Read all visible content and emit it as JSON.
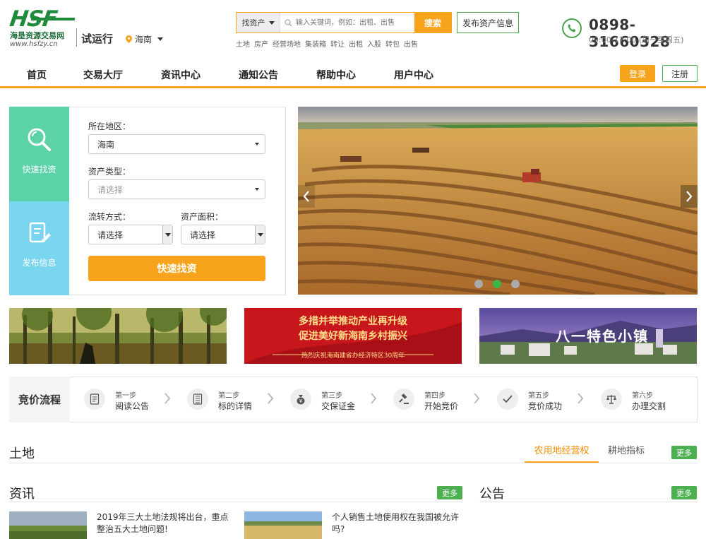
{
  "header": {
    "logo_mark": "HSF",
    "logo_name": "海垦资源交易网",
    "logo_url": "www.hsfzy.cn",
    "trial_label": "试运行",
    "region": "海南",
    "search": {
      "type": "找资产",
      "placeholder": "输入关键词，例如：出租、出售",
      "button": "搜索"
    },
    "publish_button": "发布资产信息",
    "hot_keywords": [
      "土地",
      "房产",
      "经营场地",
      "集装箱",
      "转让",
      "出租",
      "入股",
      "转包",
      "出售"
    ],
    "phone": "0898-31660328",
    "hours": "09:00-17:00 (周一至周五)"
  },
  "nav": {
    "items": [
      "首页",
      "交易大厅",
      "资讯中心",
      "通知公告",
      "帮助中心",
      "用户中心"
    ],
    "login": "登录",
    "register": "注册"
  },
  "quick_panel": {
    "tab_search": "快速找资",
    "tab_publish": "发布信息",
    "region_label": "所在地区：",
    "region_value": "海南",
    "type_label": "资产类型：",
    "type_value": "请选择",
    "transfer_label": "流转方式：",
    "transfer_value": "请选择",
    "area_label": "资产面积：",
    "area_value": "请选择",
    "button": "快速找资"
  },
  "banner": {
    "active_dot": 1,
    "dots": 3
  },
  "tiles": {
    "tile2_line1": "多措并举推动产业再升级",
    "tile2_line2": "促进美好新海南乡村振兴",
    "tile2_line3": "热烈庆祝海南建省办经济特区30周年",
    "tile3_text": "八一特色小镇"
  },
  "process": {
    "title": "竞价流程",
    "steps": [
      {
        "n": "第一步",
        "t": "阅读公告",
        "icon": "document-icon"
      },
      {
        "n": "第二步",
        "t": "标的详情",
        "icon": "list-icon"
      },
      {
        "n": "第三步",
        "t": "交保证金",
        "icon": "money-bag-icon"
      },
      {
        "n": "第四步",
        "t": "开始竞价",
        "icon": "gavel-icon"
      },
      {
        "n": "第五步",
        "t": "竞价成功",
        "icon": "check-icon"
      },
      {
        "n": "第六步",
        "t": "办理交割",
        "icon": "scale-icon"
      }
    ]
  },
  "land": {
    "title": "土地",
    "tab_active": "农用地经营权",
    "tab_other": "耕地指标",
    "more": "更多"
  },
  "news": {
    "title": "资讯",
    "more": "更多",
    "items": [
      "2019年三大土地法规将出台，重点整治五大土地问题!",
      "个人销售土地使用权在我国被允许吗?"
    ]
  },
  "notice": {
    "title": "公告",
    "more": "更多"
  },
  "colors": {
    "accent": "#f7a31b",
    "green": "#4caf50",
    "tab_search_bg": "#5bd3a6",
    "tab_publish_bg": "#7ad6ef"
  }
}
